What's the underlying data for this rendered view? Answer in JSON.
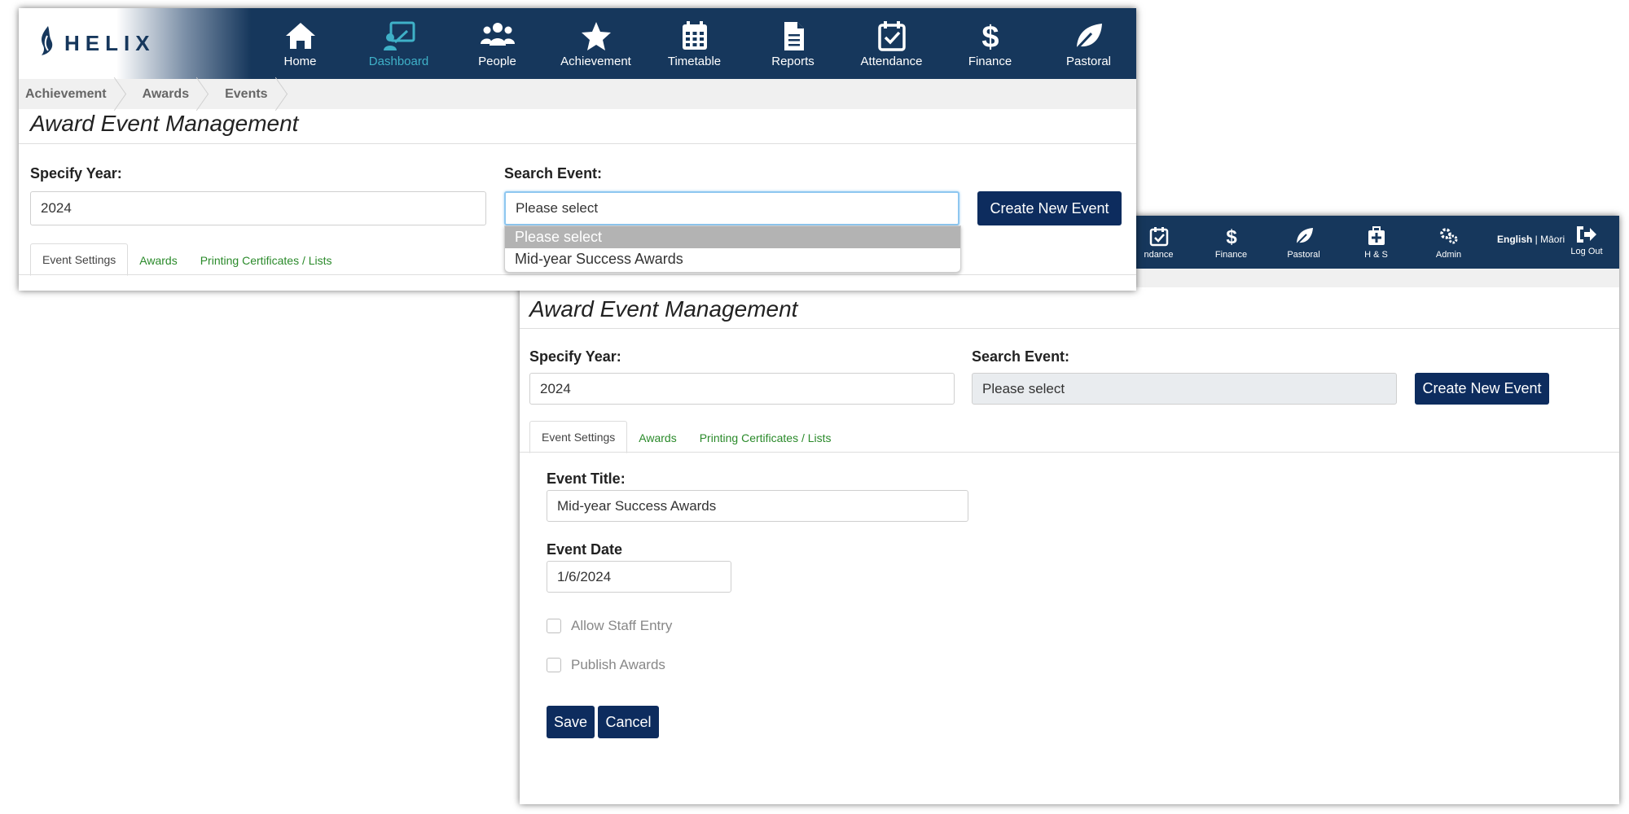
{
  "app": {
    "logo_text": "HELIX"
  },
  "nav": {
    "items": [
      {
        "label": "Home",
        "icon": "home-icon"
      },
      {
        "label": "Dashboard",
        "icon": "dashboard-icon",
        "active": true
      },
      {
        "label": "People",
        "icon": "people-icon"
      },
      {
        "label": "Achievement",
        "icon": "star-icon"
      },
      {
        "label": "Timetable",
        "icon": "calendar-icon"
      },
      {
        "label": "Reports",
        "icon": "document-icon"
      },
      {
        "label": "Attendance",
        "icon": "calendar-check-icon"
      },
      {
        "label": "Finance",
        "icon": "dollar-icon"
      },
      {
        "label": "Pastoral",
        "icon": "leaf-icon"
      }
    ]
  },
  "breadcrumb": [
    "Achievement",
    "Awards",
    "Events"
  ],
  "page_title": "Award Event Management",
  "form": {
    "year_label": "Specify Year:",
    "year_value": "2024",
    "search_label": "Search Event:",
    "search_value": "Please select",
    "create_button": "Create New Event"
  },
  "tabs": [
    "Event Settings",
    "Awards",
    "Printing Certificates / Lists"
  ],
  "dropdown": {
    "options": [
      "Please select",
      "Mid-year Success Awards"
    ]
  },
  "nav_b": {
    "items": [
      {
        "label": "ndance",
        "icon": "calendar-check-icon"
      },
      {
        "label": "Finance",
        "icon": "dollar-icon"
      },
      {
        "label": "Pastoral",
        "icon": "leaf-icon"
      },
      {
        "label": "H & S",
        "icon": "first-aid-icon"
      },
      {
        "label": "Admin",
        "icon": "gears-icon"
      }
    ],
    "lang_active": "English",
    "lang_sep": " | ",
    "lang_other": "Māori",
    "logout": "Log Out"
  },
  "event": {
    "title_label": "Event Title:",
    "title_value": "Mid-year Success Awards",
    "date_label": "Event Date",
    "date_value": "1/6/2024",
    "allow_staff": "Allow Staff Entry",
    "publish": "Publish Awards",
    "save": "Save",
    "cancel": "Cancel"
  },
  "colors": {
    "nav_bg": "#16375c",
    "button_bg": "#0d2c5e",
    "tab_link": "#2a8a2a",
    "active_nav": "#3fb1c8"
  }
}
